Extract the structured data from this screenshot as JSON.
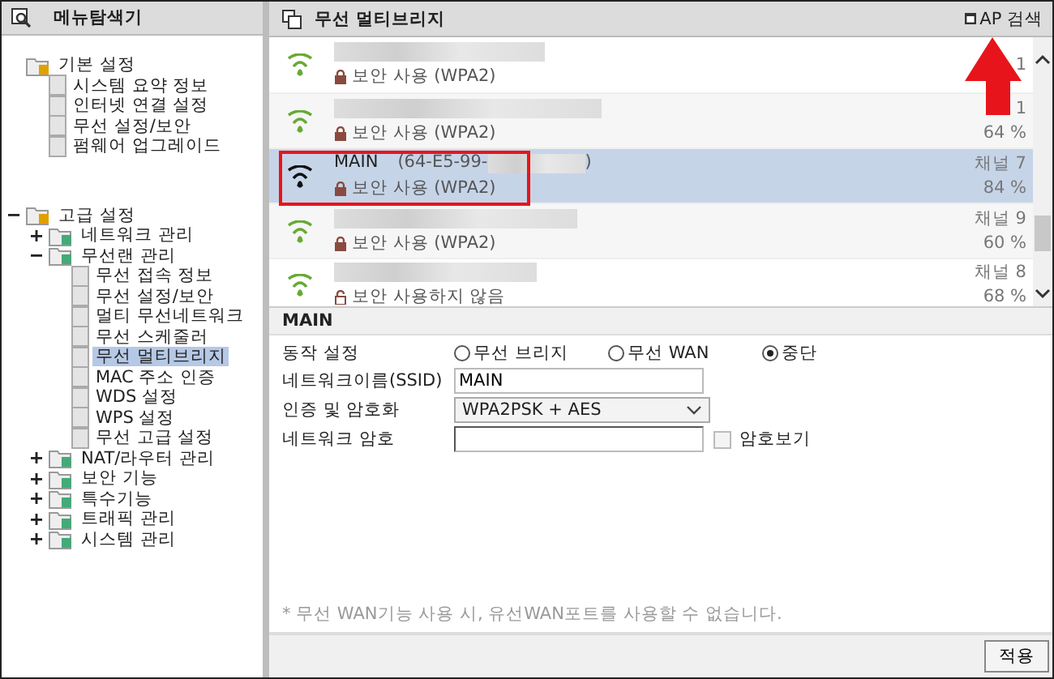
{
  "sidebar": {
    "title": "메뉴탐색기",
    "tree": [
      {
        "label": "기본 설정",
        "selected": false,
        "children": [
          {
            "label": "시스템 요약 정보",
            "selected": false
          },
          {
            "label": "인터넷 연결 설정",
            "selected": false
          },
          {
            "label": "무선 설정/보안",
            "selected": false
          },
          {
            "label": "펌웨어 업그레이드",
            "selected": false
          }
        ]
      },
      {
        "label": "고급 설정",
        "expanded": true,
        "selected": false,
        "children": [
          {
            "label": "네트워크 관리",
            "expanded": false,
            "selected": false
          },
          {
            "label": "무선랜 관리",
            "expanded": true,
            "selected": false,
            "children": [
              {
                "label": "무선 접속 정보",
                "selected": false
              },
              {
                "label": "무선 설정/보안",
                "selected": false
              },
              {
                "label": "멀티 무선네트워크",
                "selected": false
              },
              {
                "label": "무선 스케줄러",
                "selected": false
              },
              {
                "label": "무선 멀티브리지",
                "selected": true
              },
              {
                "label": "MAC 주소 인증",
                "selected": false
              },
              {
                "label": "WDS 설정",
                "selected": false
              },
              {
                "label": "WPS 설정",
                "selected": false
              },
              {
                "label": "무선 고급 설정",
                "selected": false
              }
            ]
          },
          {
            "label": "NAT/라우터 관리",
            "expanded": false,
            "selected": false
          },
          {
            "label": "보안 기능",
            "expanded": false,
            "selected": false
          },
          {
            "label": "특수기능",
            "expanded": false,
            "selected": false
          },
          {
            "label": "트래픽 관리",
            "expanded": false,
            "selected": false
          },
          {
            "label": "시스템 관리",
            "expanded": false,
            "selected": false
          }
        ]
      }
    ]
  },
  "panel": {
    "title": "무선 멀티브리지",
    "search_button": "AP 검색"
  },
  "networks": [
    {
      "selected": false,
      "secured": true,
      "security": "보안 사용 (WPA2)",
      "channel": "1"
    },
    {
      "selected": false,
      "secured": true,
      "security": "보안 사용 (WPA2)",
      "channel": "1",
      "signal": "64 %"
    },
    {
      "selected": true,
      "secured": true,
      "name": "MAIN",
      "mac_start": "(64-E5-99-",
      "mac_end": ")",
      "security": "보안 사용 (WPA2)",
      "channel": "채널 7",
      "signal": "84 %"
    },
    {
      "selected": false,
      "secured": true,
      "security": "보안 사용 (WPA2)",
      "channel": "채널 9",
      "signal": "60 %"
    },
    {
      "selected": false,
      "secured": false,
      "security": "보안 사용하지 않음",
      "channel": "채널 8",
      "signal": "68 %"
    }
  ],
  "detail": {
    "title": "MAIN",
    "mode_label": "동작 설정",
    "modes": [
      {
        "label": "무선 브리지",
        "selected": false
      },
      {
        "label": "무선 WAN",
        "selected": false
      },
      {
        "label": "중단",
        "selected": true
      }
    ],
    "ssid_label": "네트워크이름(SSID)",
    "ssid": "MAIN",
    "auth_label": "인증 및 암호화",
    "auth": "WPA2PSK + AES",
    "password_label": "네트워크 암호",
    "show_password": {
      "label": "암호보기",
      "checked": false
    },
    "note": "* 무선 WAN기능 사용 시, 유선WAN포트를 사용할 수 없습니다.",
    "apply": "적용"
  }
}
